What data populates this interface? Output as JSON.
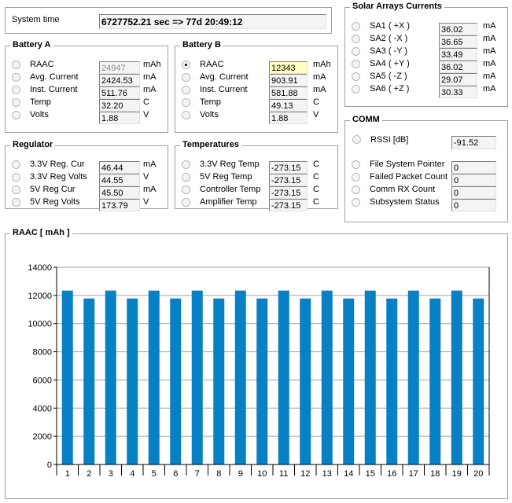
{
  "system_time": {
    "label": "System time",
    "value": "6727752.21 sec  => 77d 20:49:12"
  },
  "battery_a": {
    "title": "Battery A",
    "rows": [
      {
        "label": "RAAC",
        "value": "24947",
        "unit": "mAh",
        "selected": false,
        "disabled": true
      },
      {
        "label": "Avg. Current",
        "value": "2424.53",
        "unit": "mA",
        "selected": false
      },
      {
        "label": "Inst. Current",
        "value": "511.76",
        "unit": "mA",
        "selected": false
      },
      {
        "label": "Temp",
        "value": "32.20",
        "unit": "C",
        "selected": false
      },
      {
        "label": "Volts",
        "value": "1.88",
        "unit": "V",
        "selected": false
      }
    ]
  },
  "battery_b": {
    "title": "Battery B",
    "rows": [
      {
        "label": "RAAC",
        "value": "12343",
        "unit": "mAh",
        "selected": true,
        "highlight": "#ffffc0"
      },
      {
        "label": "Avg. Current",
        "value": "903.91",
        "unit": "mA",
        "selected": false
      },
      {
        "label": "Inst. Current",
        "value": "581.88",
        "unit": "mA",
        "selected": false
      },
      {
        "label": "Temp",
        "value": "49.13",
        "unit": "C",
        "selected": false
      },
      {
        "label": "Volts",
        "value": "1.88",
        "unit": "V",
        "selected": false
      }
    ]
  },
  "regulator": {
    "title": "Regulator",
    "rows": [
      {
        "label": "3.3V Reg. Cur",
        "value": "46.44",
        "unit": "mA"
      },
      {
        "label": "3.3V Reg Volts",
        "value": "44.55",
        "unit": "V"
      },
      {
        "label": "5V Reg Cur",
        "value": "45.50",
        "unit": "mA"
      },
      {
        "label": "5V Reg Volts",
        "value": "173.79",
        "unit": "V"
      }
    ]
  },
  "temperatures": {
    "title": "Temperatures",
    "rows": [
      {
        "label": "3.3V Reg Temp",
        "value": "-273.15",
        "unit": "C"
      },
      {
        "label": "5V Reg Temp",
        "value": "-273.15",
        "unit": "C"
      },
      {
        "label": "Controller Temp",
        "value": "-273.15",
        "unit": "C"
      },
      {
        "label": "Amplifier Temp",
        "value": "-273.15",
        "unit": "C"
      }
    ]
  },
  "solar": {
    "title": "Solar Arrays Currents",
    "rows": [
      {
        "label": "SA1 ( +X )",
        "value": "36.02",
        "unit": "mA"
      },
      {
        "label": "SA2 ( -X )",
        "value": "36.65",
        "unit": "mA"
      },
      {
        "label": "SA3 ( -Y )",
        "value": "33.49",
        "unit": "mA"
      },
      {
        "label": "SA4 ( +Y )",
        "value": "36.02",
        "unit": "mA"
      },
      {
        "label": "SA5 ( -Z )",
        "value": "29.07",
        "unit": "mA"
      },
      {
        "label": "SA6 ( +Z )",
        "value": "30.33",
        "unit": "mA"
      }
    ]
  },
  "comm": {
    "title": "COMM",
    "rssi": {
      "label": "RSSI [dB]",
      "value": "-91.52"
    },
    "rows": [
      {
        "label": "File System Pointer",
        "value": "0"
      },
      {
        "label": "Failed Packet Count",
        "value": "0"
      },
      {
        "label": "Comm RX Count",
        "value": "0"
      },
      {
        "label": "Subsystem Status",
        "value": "0"
      }
    ]
  },
  "chart_data": {
    "type": "bar",
    "title": "RAAC  [ mAh ]",
    "categories": [
      "1",
      "2",
      "3",
      "4",
      "5",
      "6",
      "7",
      "8",
      "9",
      "10",
      "11",
      "12",
      "13",
      "14",
      "15",
      "16",
      "17",
      "18",
      "19",
      "20"
    ],
    "values": [
      12343,
      11780,
      12343,
      11780,
      12343,
      11780,
      12343,
      11780,
      12343,
      11780,
      12343,
      11780,
      12343,
      11780,
      12343,
      11780,
      12343,
      11780,
      12343,
      11780
    ],
    "ylim": [
      0,
      14000
    ],
    "yticks": [
      "0",
      "2000",
      "4000",
      "6000",
      "8000",
      "10000",
      "12000",
      "14000"
    ],
    "grid": true,
    "bar_color": "#0780c4"
  }
}
